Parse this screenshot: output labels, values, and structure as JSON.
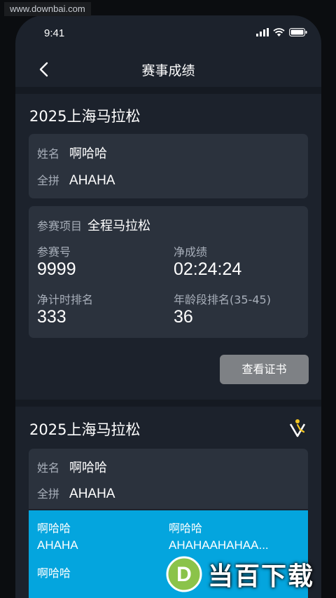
{
  "watermark": {
    "text": "www.downbai.com"
  },
  "status_bar": {
    "time": "9:41"
  },
  "nav": {
    "title": "赛事成绩"
  },
  "card1": {
    "race_title": "2025上海马拉松",
    "name_label": "姓名",
    "name_value": "啊哈哈",
    "pinyin_label": "全拼",
    "pinyin_value": "AHAHA",
    "event_label": "参赛项目",
    "event_value": "全程马拉松",
    "bib_label": "参赛号",
    "bib_value": "9999",
    "net_time_label": "净成绩",
    "net_time_value": "02:24:24",
    "net_rank_label": "净计时排名",
    "net_rank_value": "333",
    "age_rank_label": "年龄段排名(35-45)",
    "age_rank_value": "36",
    "cert_button": "查看证书"
  },
  "card2": {
    "race_title": "2025上海马拉松",
    "name_label": "姓名",
    "name_value": "啊哈哈",
    "pinyin_label": "全拼",
    "pinyin_value": "AHAHA",
    "blue": {
      "left_name": "啊哈哈",
      "left_pinyin": "AHAHA",
      "right_name": "啊哈哈",
      "right_pinyin": "AHAHAAHAHAA...",
      "bottom_name": "啊哈哈"
    }
  },
  "brand_watermark": {
    "letter": "D",
    "text": "当百下载"
  },
  "colors": {
    "background": "#1c222c",
    "panel": "#2b323d",
    "accent_blue": "#04a5de",
    "button_gray": "#7e8185"
  }
}
